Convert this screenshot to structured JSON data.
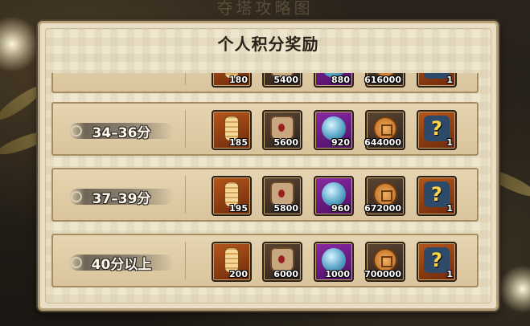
{
  "background": {
    "title": "夺塔攻略图"
  },
  "panel": {
    "title": "个人积分奖励"
  },
  "rows": [
    {
      "label": "",
      "items": [
        {
          "icon": "scroll-icon",
          "qty": "180"
        },
        {
          "icon": "gift-bag-icon",
          "qty": "5400"
        },
        {
          "icon": "spirit-orb-icon",
          "qty": "880"
        },
        {
          "icon": "coin-icon",
          "qty": "616000"
        },
        {
          "icon": "mystery-box-icon",
          "qty": "1"
        }
      ]
    },
    {
      "label": "34–36分",
      "items": [
        {
          "icon": "scroll-icon",
          "qty": "185"
        },
        {
          "icon": "gift-bag-icon",
          "qty": "5600"
        },
        {
          "icon": "spirit-orb-icon",
          "qty": "920"
        },
        {
          "icon": "coin-icon",
          "qty": "644000"
        },
        {
          "icon": "mystery-box-icon",
          "qty": "1"
        }
      ]
    },
    {
      "label": "37–39分",
      "items": [
        {
          "icon": "scroll-icon",
          "qty": "195"
        },
        {
          "icon": "gift-bag-icon",
          "qty": "5800"
        },
        {
          "icon": "spirit-orb-icon",
          "qty": "960"
        },
        {
          "icon": "coin-icon",
          "qty": "672000"
        },
        {
          "icon": "mystery-box-icon",
          "qty": "1"
        }
      ]
    },
    {
      "label": "40分以上",
      "items": [
        {
          "icon": "scroll-icon",
          "qty": "200"
        },
        {
          "icon": "gift-bag-icon",
          "qty": "6000"
        },
        {
          "icon": "spirit-orb-icon",
          "qty": "1000"
        },
        {
          "icon": "coin-icon",
          "qty": "700000"
        },
        {
          "icon": "mystery-box-icon",
          "qty": "1"
        }
      ]
    }
  ],
  "colors": {
    "panel": "#efe6cf",
    "row": "#d9c49c",
    "orange_slot": "#b5561c",
    "purple_slot": "#8b2aa5"
  }
}
